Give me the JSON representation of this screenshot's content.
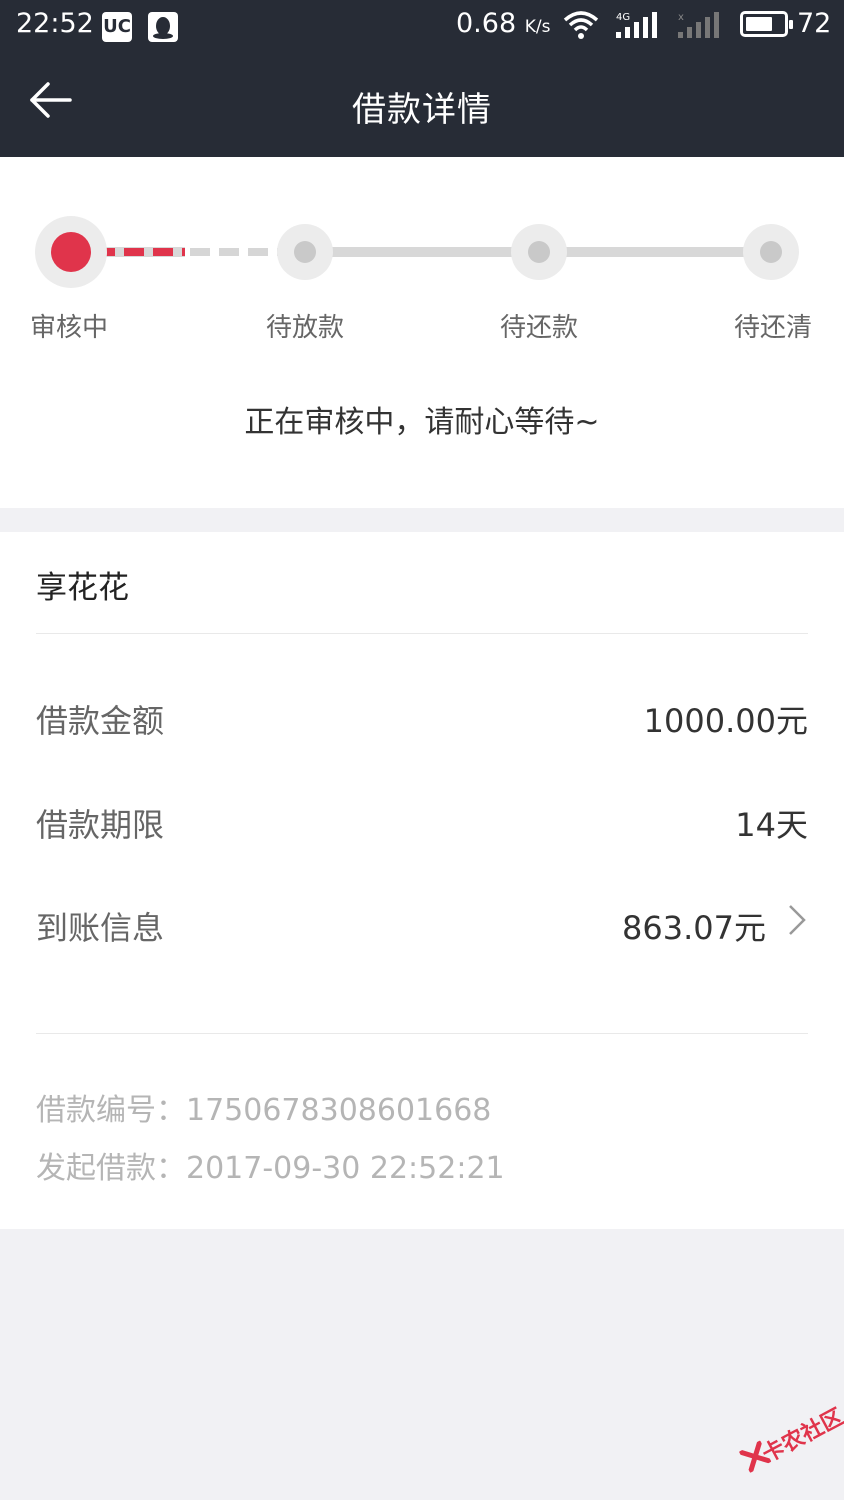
{
  "status_bar": {
    "time": "22:52",
    "app_icons": [
      "uc-browser-icon",
      "qq-icon"
    ],
    "net_speed_value": "0.68",
    "net_speed_unit": "K/s",
    "battery_level": "72",
    "battery_fraction": 0.72
  },
  "header": {
    "title": "借款详情",
    "back_icon": "arrow-left-icon"
  },
  "progress": {
    "steps": [
      {
        "label": "审核中",
        "active": true
      },
      {
        "label": "待放款",
        "active": false
      },
      {
        "label": "待还款",
        "active": false
      },
      {
        "label": "待还清",
        "active": false
      }
    ],
    "message": "正在审核中，请耐心等待~",
    "accent_color": "#e0344b"
  },
  "loan": {
    "product_name": "享花花",
    "rows": [
      {
        "label": "借款金额",
        "value": "1000.00元"
      },
      {
        "label": "借款期限",
        "value": "14天"
      },
      {
        "label": "到账信息",
        "value": "863.07元"
      }
    ],
    "loan_number_label": "借款编号：",
    "loan_number": "1750678308601668",
    "initiated_label": "发起借款：",
    "initiated_time": "2017-09-30 22:52:21"
  },
  "watermark": {
    "text": "卡农社区"
  }
}
